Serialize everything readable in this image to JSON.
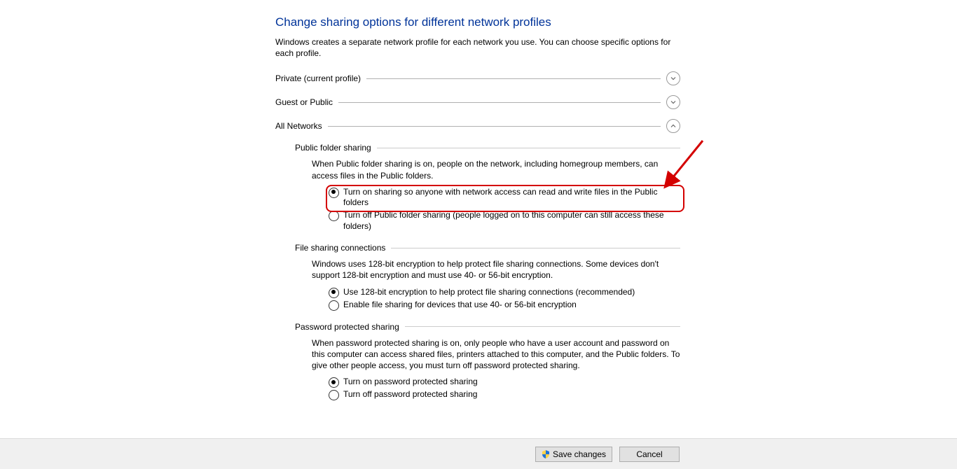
{
  "title": "Change sharing options for different network profiles",
  "intro": "Windows creates a separate network profile for each network you use. You can choose specific options for each profile.",
  "sections": {
    "private": {
      "label": "Private (current profile)",
      "expanded": false
    },
    "guest": {
      "label": "Guest or Public",
      "expanded": false
    },
    "all": {
      "label": "All Networks",
      "expanded": true
    }
  },
  "all_networks": {
    "public_folder": {
      "heading": "Public folder sharing",
      "desc": "When Public folder sharing is on, people on the network, including homegroup members, can access files in the Public folders.",
      "opt_on": "Turn on sharing so anyone with network access can read and write files in the Public folders",
      "opt_off": "Turn off Public folder sharing (people logged on to this computer can still access these folders)",
      "selected": "on"
    },
    "file_sharing": {
      "heading": "File sharing connections",
      "desc": "Windows uses 128-bit encryption to help protect file sharing connections. Some devices don't support 128-bit encryption and must use 40- or 56-bit encryption.",
      "opt_128": "Use 128-bit encryption to help protect file sharing connections (recommended)",
      "opt_40": "Enable file sharing for devices that use 40- or 56-bit encryption",
      "selected": "128"
    },
    "password": {
      "heading": "Password protected sharing",
      "desc": "When password protected sharing is on, only people who have a user account and password on this computer can access shared files, printers attached to this computer, and the Public folders. To give other people access, you must turn off password protected sharing.",
      "opt_on": "Turn on password protected sharing",
      "opt_off": "Turn off password protected sharing",
      "selected": "on"
    }
  },
  "footer": {
    "save": "Save changes",
    "cancel": "Cancel"
  },
  "annotation": {
    "highlight_target": "public-folder-on"
  }
}
